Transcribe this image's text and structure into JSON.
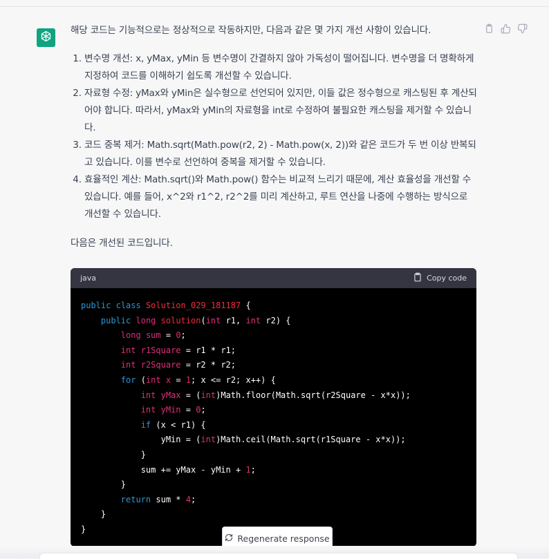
{
  "message": {
    "intro": "해당 코드는 기능적으로는 정상적으로 작동하지만, 다음과 같은 몇 가지 개선 사항이 있습니다.",
    "items": [
      "변수명 개선: x, yMax, yMin 등 변수명이 간결하지 않아 가독성이 떨어집니다. 변수명을 더 명확하게 지정하여 코드를 이해하기 쉽도록 개선할 수 있습니다.",
      "자료형 수정: yMax와 yMin은 실수형으로 선언되어 있지만, 이들 값은 정수형으로 캐스팅된 후 계산되어야 합니다. 따라서, yMax와 yMin의 자료형을 int로 수정하여 불필요한 캐스팅을 제거할 수 있습니다.",
      "코드 중복 제거: Math.sqrt(Math.pow(r2, 2) - Math.pow(x, 2))와 같은 코드가 두 번 이상 반복되고 있습니다. 이를 변수로 선언하여 중복을 제거할 수 있습니다.",
      "효율적인 계산: Math.sqrt()와 Math.pow() 함수는 비교적 느리기 때문에, 계산 효율성을 개선할 수 있습니다. 예를 들어, x^2와 r1^2, r2^2를 미리 계산하고, 루트 연산을 나중에 수행하는 방식으로 개선할 수 있습니다."
    ],
    "outro": "다음은 개선된 코드입니다."
  },
  "code": {
    "language": "java",
    "copy_label": "Copy code"
  },
  "regenerate_label": "Regenerate response",
  "colors": {
    "avatar_bg": "#10a37f",
    "keyword": "#2e95d3",
    "type": "#df3079",
    "class_name": "#f22c3d"
  },
  "icons": [
    "openai-logo-icon",
    "clipboard-icon",
    "thumbs-up-icon",
    "thumbs-down-icon",
    "copy-icon",
    "refresh-icon"
  ]
}
